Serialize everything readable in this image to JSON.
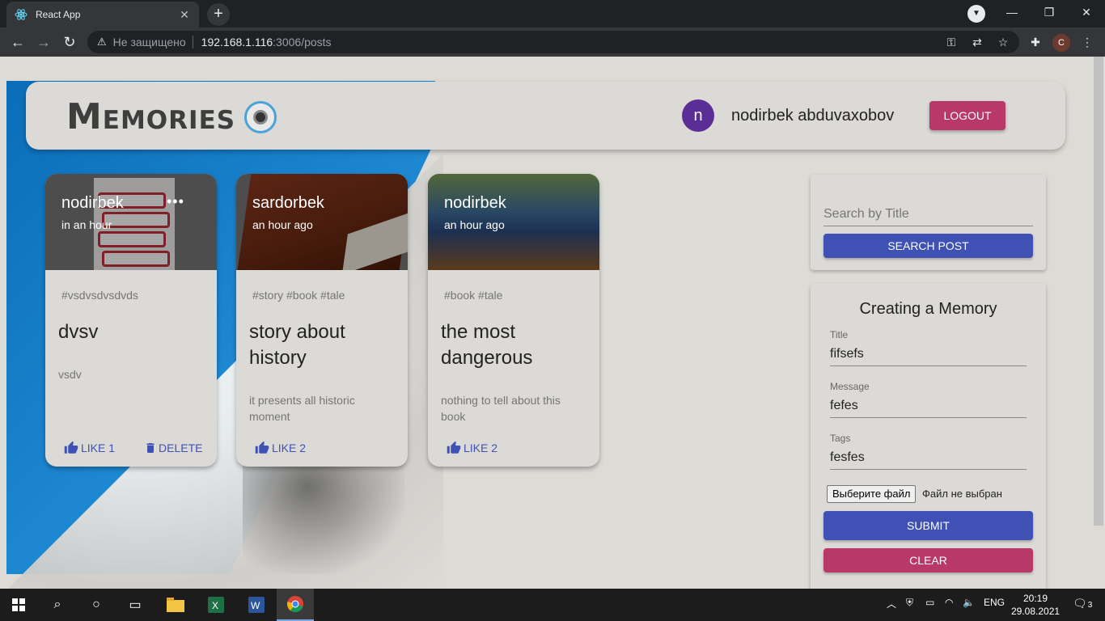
{
  "browser": {
    "tab_title": "React App",
    "tab_close": "✕",
    "new_tab": "+",
    "security_text": "Не защищено",
    "url_host": "192.168.1.116",
    "url_path": ":3006/posts",
    "profile_initial": "C"
  },
  "header": {
    "logo_text": "Memories",
    "avatar_initial": "n",
    "username": "nodirbek abduvaxobov",
    "logout_label": "LOGOUT"
  },
  "posts": [
    {
      "author": "nodirbek",
      "time": "in an hour",
      "tags": "#vsdvsdvsdvds",
      "title": "dvsv",
      "message": "vsdv",
      "like_label": "LIKE 1",
      "delete_label": "DELETE",
      "more": "•••"
    },
    {
      "author": "sardorbek",
      "time": "an hour ago",
      "tags": "#story #book #tale",
      "title": "story about history",
      "message": "it presents all historic moment",
      "like_label": "LIKE 2"
    },
    {
      "author": "nodirbek",
      "time": "an hour ago",
      "tags": "#book #tale",
      "title": "the most dangerous",
      "message": "nothing to tell about this book",
      "like_label": "LIKE 2"
    }
  ],
  "search": {
    "placeholder": "Search by Title",
    "button_label": "SEARCH POST"
  },
  "form": {
    "title": "Creating a Memory",
    "title_label": "Title",
    "title_value": "fifsefs",
    "message_label": "Message",
    "message_value": "fefes",
    "tags_label": "Tags",
    "tags_value": "fesfes",
    "file_button": "Выберите файл",
    "file_status": "Файл не выбран",
    "submit_label": "SUBMIT",
    "clear_label": "CLEAR"
  },
  "taskbar": {
    "language": "ENG",
    "time": "20:19",
    "date": "29.08.2021",
    "notifications": "3"
  },
  "colors": {
    "primary": "#3f51b5",
    "secondary": "#b8386a",
    "avatar": "#5b2d96",
    "page_bg": "#dddbd6"
  }
}
